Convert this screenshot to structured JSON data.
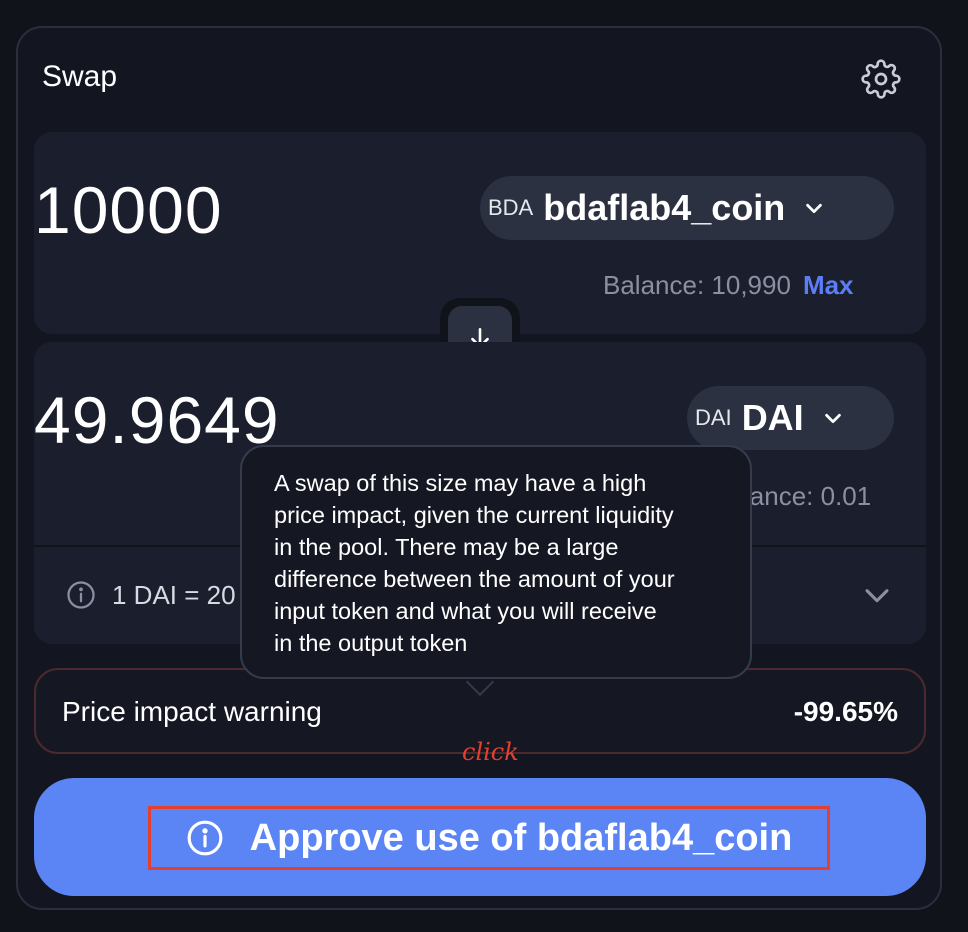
{
  "header": {
    "title": "Swap",
    "settings_icon": "gear-icon"
  },
  "from": {
    "amount": "10000",
    "token_symbol": "BDA",
    "token_name": "bdaflab4_coin",
    "balance": "Balance: 10,990",
    "max_label": "Max"
  },
  "to": {
    "amount": "49.9649",
    "token_symbol": "DAI",
    "token_name": "DAI",
    "balance": "lance: 0.01"
  },
  "rate": {
    "text": "1 DAI = 20"
  },
  "tooltip": {
    "lines": [
      "A swap of this size may have a high",
      "price impact, given the current liquidity",
      "in the pool. There may be a large",
      "difference between the amount of your",
      "input token and what you will receive",
      "in the output token"
    ]
  },
  "price_impact": {
    "label": "Price impact warning",
    "value": "-99.65%"
  },
  "annotation": {
    "text": "click",
    "color": "#e53f2f"
  },
  "approve_button": {
    "label": "Approve use of bdaflab4_coin"
  },
  "colors": {
    "accent": "#5b84f5",
    "link": "#5b7ef6",
    "background": "#11131b",
    "panel": "#1b1f2d"
  }
}
